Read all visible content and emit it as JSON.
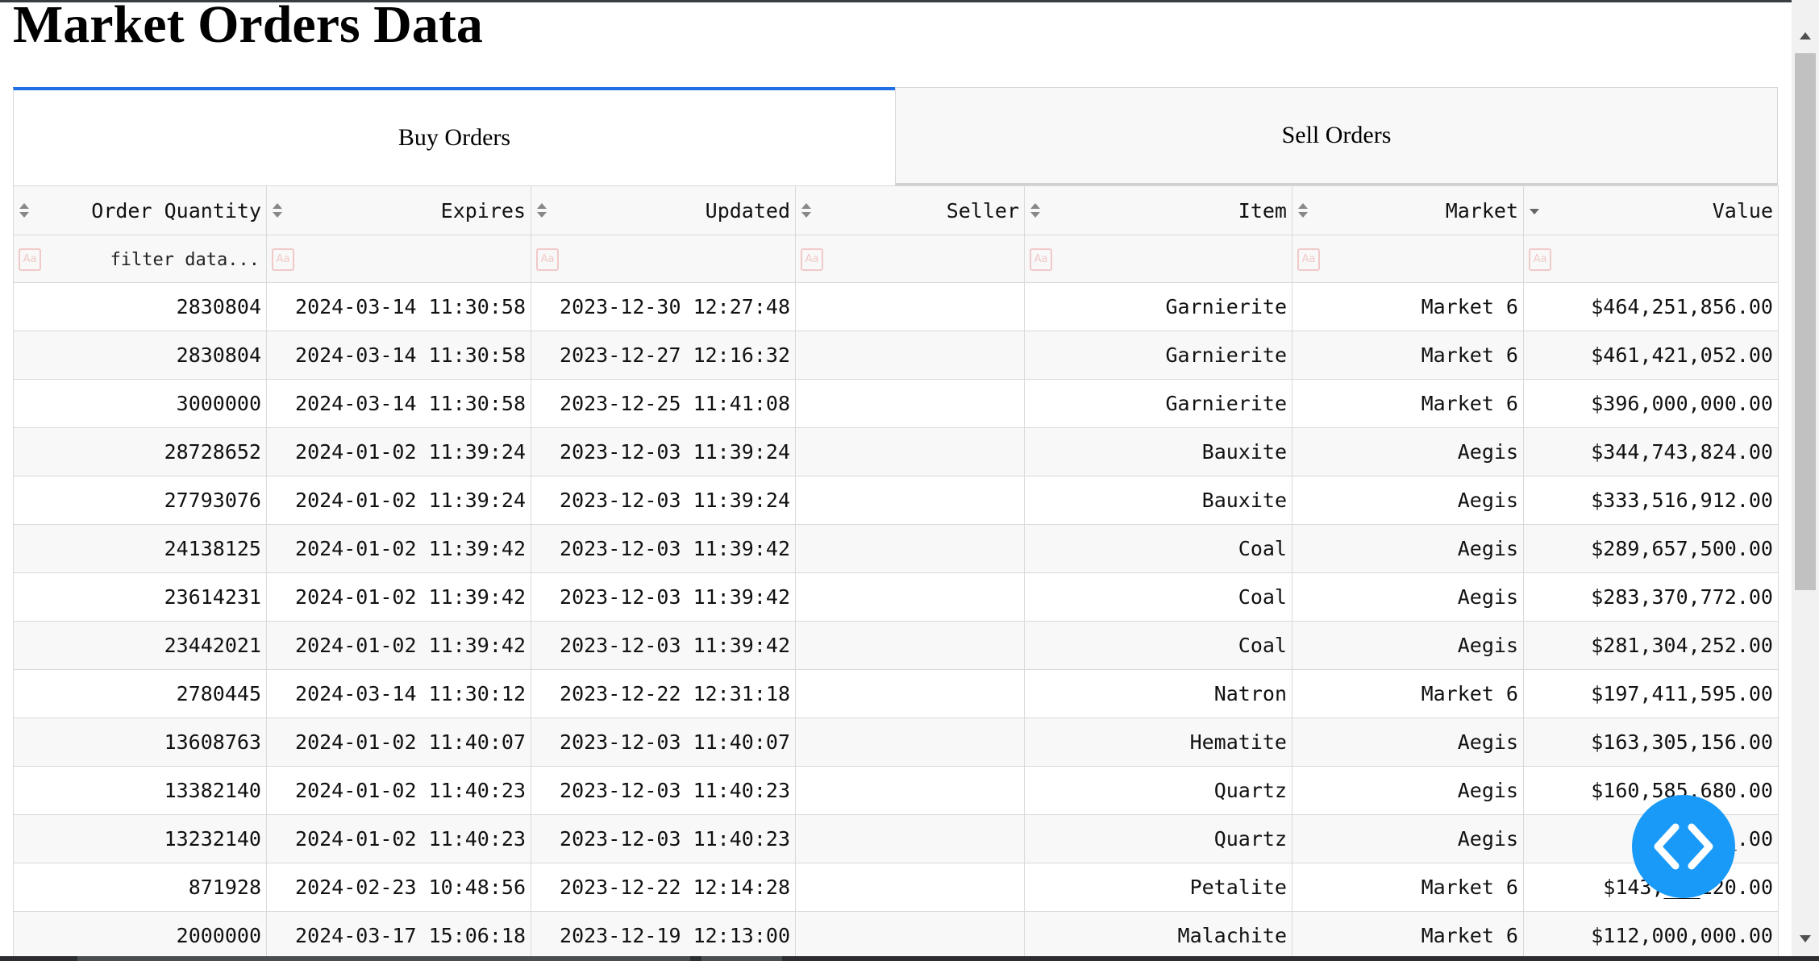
{
  "page": {
    "title": "Market Orders Data"
  },
  "tabs": [
    {
      "label": "Buy Orders",
      "active": true
    },
    {
      "label": "Sell Orders",
      "active": false
    }
  ],
  "table": {
    "columns": [
      "Order Quantity",
      "Expires",
      "Updated",
      "Seller",
      "Item",
      "Market",
      "Value"
    ],
    "sort": {
      "column": "Value",
      "direction": "descending"
    },
    "filter_placeholder": "filter data...",
    "rows": [
      [
        "2830804",
        "2024-03-14 11:30:58",
        "2023-12-30 12:27:48",
        "",
        "Garnierite",
        "Market 6",
        "$464,251,856.00"
      ],
      [
        "2830804",
        "2024-03-14 11:30:58",
        "2023-12-27 12:16:32",
        "",
        "Garnierite",
        "Market 6",
        "$461,421,052.00"
      ],
      [
        "3000000",
        "2024-03-14 11:30:58",
        "2023-12-25 11:41:08",
        "",
        "Garnierite",
        "Market 6",
        "$396,000,000.00"
      ],
      [
        "28728652",
        "2024-01-02 11:39:24",
        "2023-12-03 11:39:24",
        "",
        "Bauxite",
        "Aegis",
        "$344,743,824.00"
      ],
      [
        "27793076",
        "2024-01-02 11:39:24",
        "2023-12-03 11:39:24",
        "",
        "Bauxite",
        "Aegis",
        "$333,516,912.00"
      ],
      [
        "24138125",
        "2024-01-02 11:39:42",
        "2023-12-03 11:39:42",
        "",
        "Coal",
        "Aegis",
        "$289,657,500.00"
      ],
      [
        "23614231",
        "2024-01-02 11:39:42",
        "2023-12-03 11:39:42",
        "",
        "Coal",
        "Aegis",
        "$283,370,772.00"
      ],
      [
        "23442021",
        "2024-01-02 11:39:42",
        "2023-12-03 11:39:42",
        "",
        "Coal",
        "Aegis",
        "$281,304,252.00"
      ],
      [
        "2780445",
        "2024-03-14 11:30:12",
        "2023-12-22 12:31:18",
        "",
        "Natron",
        "Market 6",
        "$197,411,595.00"
      ],
      [
        "13608763",
        "2024-01-02 11:40:07",
        "2023-12-03 11:40:07",
        "",
        "Hematite",
        "Aegis",
        "$163,305,156.00"
      ],
      [
        "13382140",
        "2024-01-02 11:40:23",
        "2023-12-03 11:40:23",
        "",
        "Quartz",
        "Aegis",
        "$160,585,680.00"
      ],
      [
        "13232140",
        "2024-01-02 11:40:23",
        "2023-12-03 11:40:23",
        "",
        "Quartz",
        "Aegis",
        "$15____.00"
      ],
      [
        "871928",
        "2024-02-23 10:48:56",
        "2023-12-22 12:14:28",
        "",
        "Petalite",
        "Market 6",
        "$143,___120.00"
      ],
      [
        "2000000",
        "2024-03-17 15:06:18",
        "2023-12-19 12:13:00",
        "",
        "Malachite",
        "Market 6",
        "$112,000,000.00"
      ]
    ]
  },
  "icons": {
    "sort": "sort-arrows-icon",
    "filter": "text-filter-icon",
    "fab": "code-brackets-icon"
  },
  "colors": {
    "accent": "#1f6fe5",
    "fab": "#1a9af8",
    "filter_icon": "#f1c9c9"
  }
}
